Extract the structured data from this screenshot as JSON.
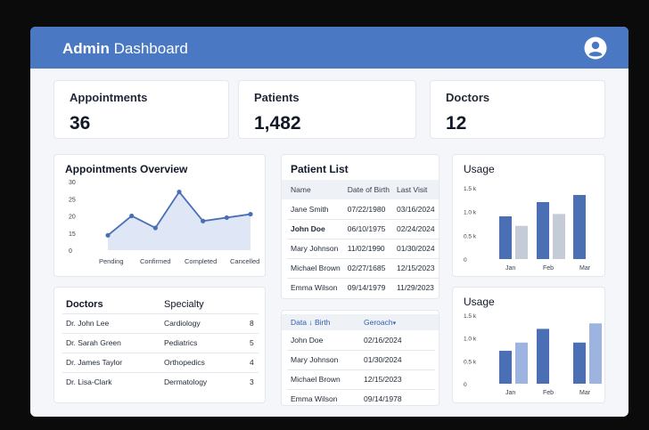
{
  "header": {
    "title_bold": "Admin",
    "title_rest": "Dashboard",
    "avatar_icon": "user-circle-icon",
    "color": "#4a78c2"
  },
  "stats": [
    {
      "label": "Appointments",
      "value": "36"
    },
    {
      "label": "Patients",
      "value": "1,482"
    },
    {
      "label": "Doctors",
      "value": "12"
    }
  ],
  "appointments_overview": {
    "title": "Appointments Overview"
  },
  "patient_list": {
    "title": "Patient List",
    "columns": [
      "Name",
      "Date of Birth",
      "Last Visit"
    ],
    "rows": [
      [
        "Jane Smith",
        "07/22/1980",
        "03/16/2024"
      ],
      [
        "John Doe",
        "06/10/1975",
        "02/24/2024"
      ],
      [
        "Mary Johnson",
        "11/02/1990",
        "01/30/2024"
      ],
      [
        "Michael Brown",
        "02/27/1685",
        "12/15/2023"
      ],
      [
        "Emma Wilson",
        "09/14/1979",
        "11/29/2023"
      ]
    ]
  },
  "doctors_table": {
    "columns": [
      "Doctors",
      "Specialty"
    ],
    "rows": [
      [
        "Dr. John Lee",
        "Cardiology",
        "8"
      ],
      [
        "Dr. Sarah Green",
        "Pediatrics",
        "5"
      ],
      [
        "Dr. James Taylor",
        "Orthopedics",
        "4"
      ],
      [
        "Dr. Lisa-Clark",
        "Dermatology",
        "3"
      ]
    ]
  },
  "secondary_table": {
    "col1": "Data",
    "col1_icon": "sort-down-icon",
    "col1_suffix": "Birth",
    "col2": "Geroach",
    "col2_icon": "chevron-down-icon",
    "rows": [
      [
        "John Doe",
        "02/16/2024"
      ],
      [
        "Mary Johnson",
        "01/30/2024"
      ],
      [
        "Michael Brown",
        "12/15/2023"
      ],
      [
        "Emma Wilson",
        "09/14/1978"
      ]
    ]
  },
  "chart_data": [
    {
      "type": "area",
      "title": "Appointments Overview",
      "xlabel": "",
      "ylabel": "",
      "ylim": [
        0,
        30
      ],
      "yticks": [
        0,
        15,
        20,
        25,
        30
      ],
      "x_tick_labels": [
        "Pending",
        "Confirmed",
        "Completed",
        "Cancelled"
      ],
      "series": [
        {
          "values": [
            13,
            20,
            16.5,
            27,
            18.5,
            19.5,
            20.5
          ]
        }
      ],
      "color": "#4a6fb5",
      "grid": false
    },
    {
      "type": "bar",
      "title": "Usage",
      "categories": [
        "Jan",
        "Feb",
        "Mar"
      ],
      "yticks": [
        "0",
        "0.5 k",
        "1.0 k",
        "1.5 k"
      ],
      "ylim": [
        0,
        1.5
      ],
      "bars": [
        {
          "category": "Jan",
          "values": [
            0.9,
            0.7
          ]
        },
        {
          "category": "Feb",
          "values": [
            1.2,
            0.95
          ]
        },
        {
          "category": "Mar",
          "values": [
            1.35
          ]
        }
      ],
      "colors": [
        "#4a6fb5",
        "#c5ccd8"
      ],
      "grid": false
    },
    {
      "type": "bar",
      "title": "Usage",
      "categories": [
        "Jan",
        "Feb",
        "Mar"
      ],
      "yticks": [
        "0",
        "0.5 k",
        "1.0 k",
        "1.5 k"
      ],
      "ylim": [
        0,
        1.5
      ],
      "bars": [
        {
          "category": "Jan",
          "values": [
            0.72,
            0.9
          ]
        },
        {
          "category": "Feb",
          "values": [
            1.2,
            0.0
          ]
        },
        {
          "category": "Mar",
          "values": [
            0.9,
            1.32
          ]
        }
      ],
      "colors": [
        "#4a6fb5",
        "#9db4e0"
      ],
      "grid": false
    }
  ]
}
